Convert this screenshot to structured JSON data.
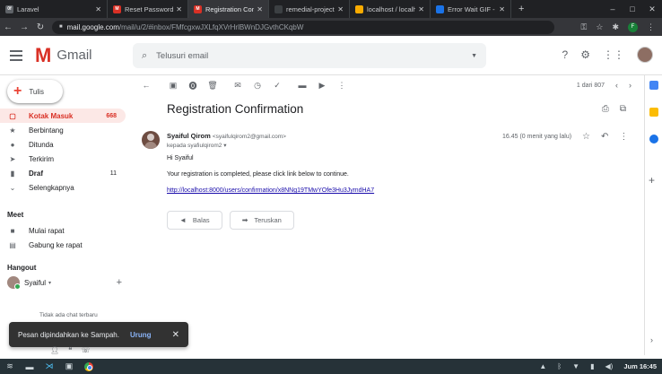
{
  "browser": {
    "tabs": [
      {
        "title": "Laravel",
        "favicon_color": "#5f6368",
        "favicon_text": "0f"
      },
      {
        "title": "Reset Password - fa",
        "favicon_color": "#d93025",
        "favicon_text": "M"
      },
      {
        "title": "Registration Confirm",
        "favicon_color": "#d93025",
        "favicon_text": "M"
      },
      {
        "title": "remedial-project-lar",
        "favicon_color": "#3c4043",
        "favicon_text": ""
      },
      {
        "title": "localhost / localhost",
        "favicon_color": "#f9ab00",
        "favicon_text": ""
      },
      {
        "title": "Error Wait GIF - Erro",
        "favicon_color": "#1a73e8",
        "favicon_text": ""
      }
    ],
    "new_tab": "+",
    "url_host": "mail.google.com",
    "url_path": "/mail/u/2/#inbox/FMfcgxwJXLfqXVrHrlBWnDJGvthCKqbW",
    "window_controls": [
      "–",
      "□",
      "✕"
    ]
  },
  "gmail": {
    "brand": "Gmail",
    "search_placeholder": "Telusuri email",
    "compose_label": "Tulis",
    "nav": [
      {
        "label": "Kotak Masuk",
        "count": "668",
        "icon": "inbox-icon",
        "glyph": "▢"
      },
      {
        "label": "Berbintang",
        "count": "",
        "icon": "star-icon",
        "glyph": "★"
      },
      {
        "label": "Ditunda",
        "count": "",
        "icon": "clock-icon",
        "glyph": "●"
      },
      {
        "label": "Terkirim",
        "count": "",
        "icon": "send-icon",
        "glyph": "➤"
      },
      {
        "label": "Draf",
        "count": "11",
        "icon": "draft-icon",
        "glyph": "▮"
      },
      {
        "label": "Selengkapnya",
        "count": "",
        "icon": "chevron-down-icon",
        "glyph": "⌄"
      }
    ],
    "meet": {
      "title": "Meet",
      "items": [
        {
          "label": "Mulai rapat",
          "icon": "video-icon",
          "glyph": "■"
        },
        {
          "label": "Gabung ke rapat",
          "icon": "keyboard-icon",
          "glyph": "▤"
        }
      ]
    },
    "hangout": {
      "title": "Hangout",
      "user": "Syaiful",
      "user_suffix": "▾",
      "no_chat": "Tidak ada chat terbaru"
    },
    "toast": {
      "message": "Pesan dipindahkan ke Sampah.",
      "undo": "Urung",
      "close": "✕"
    },
    "pager": {
      "text": "1 dari 807"
    },
    "email": {
      "subject": "Registration Confirmation",
      "sender_name": "Syaiful Qirom",
      "sender_email": "<syaifulqirom2@gmail.com>",
      "recipient": "kepada syafiulqirom2 ▾",
      "time": "16.45 (0 menit yang lalu)",
      "greeting": "Hi Syaiful",
      "body_line": "Your registration is completed, please click link below to continue.",
      "link": "http://localhost:8000/users/confirmation/x8NNg19TMwYOfe3Hu3JymdHA7",
      "reply_label": "Balas",
      "forward_label": "Teruskan"
    }
  },
  "taskbar": {
    "clock": "Jum 16:45"
  },
  "colors": {
    "accent_red": "#d93025",
    "active_bg": "#fce8e6",
    "link": "#1a0dab"
  }
}
